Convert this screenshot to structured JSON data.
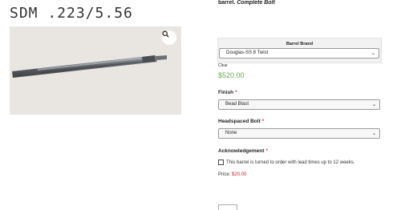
{
  "product": {
    "title": "SDM .223/5.56",
    "image_alt": "rifle barrel",
    "zoom_icon": "magnifier-icon"
  },
  "topline": {
    "text": "barrel. ",
    "italic": "Complete Bolt"
  },
  "barrel_brand": {
    "heading": "Barrel Brand",
    "selected": "Douglas-SS 8 Twist"
  },
  "clear_label": "Clear",
  "variation_price": "$520.00",
  "finish": {
    "label": "Finish",
    "required_mark": "*",
    "selected": "Bead Blast"
  },
  "headspaced_bolt": {
    "label": "Headspaced Bolt",
    "required_mark": "*",
    "selected": "None"
  },
  "acknowledgement": {
    "label": "Acknowledgement",
    "required_mark": "*",
    "checkbox_text": "This barrel is turned to order with lead times up to 12 weeks."
  },
  "price_line": {
    "label": "Price: ",
    "value": "$20.00"
  },
  "colors": {
    "price_green": "#6aa84f",
    "required_red": "#dd3333",
    "price_red": "#bb2233"
  }
}
